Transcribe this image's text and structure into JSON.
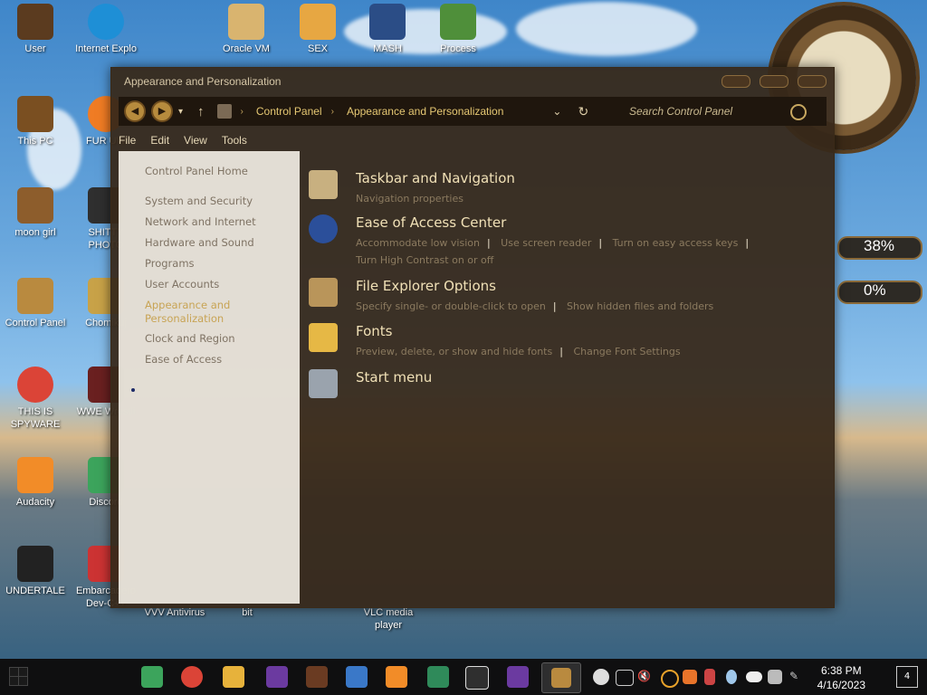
{
  "desktop": {
    "icons": [
      {
        "label": "User",
        "icon": "user-folder-icon",
        "color": "#5b3b1f"
      },
      {
        "label": "This PC",
        "icon": "this-pc-icon",
        "color": "#7a4f21"
      },
      {
        "label": "moon girl",
        "icon": "moon-girl-icon",
        "color": "#8d5d2c"
      },
      {
        "label": "Control Panel",
        "icon": "control-panel-icon",
        "color": "#b98a3f"
      },
      {
        "label": "THIS IS SPYWARE",
        "icon": "chrome-icon",
        "color": "#db4437"
      },
      {
        "label": "Audacity",
        "icon": "audacity-icon",
        "color": "#f28c28"
      },
      {
        "label": "UNDERTALE",
        "icon": "unity-icon",
        "color": "#222222"
      }
    ],
    "icons_col2": [
      {
        "label": "Internet Explo",
        "icon": "edge-icon",
        "color": "#1e8fd6"
      },
      {
        "label": "FUR UW",
        "icon": "firefox-icon",
        "color": "#f07c24"
      },
      {
        "label": "SHITTY PHOTO",
        "icon": "cat-icon",
        "color": "#2f2f2f"
      },
      {
        "label": "Chomikuj",
        "icon": "chomik-icon",
        "color": "#c8a248"
      },
      {
        "label": "WWE Wrestli",
        "icon": "wwe-icon",
        "color": "#6a2020"
      },
      {
        "label": "Discord",
        "icon": "discord-icon",
        "color": "#3ca45c"
      },
      {
        "label": "Embarcadero Dev-C++",
        "icon": "devcpp-icon",
        "color": "#cc3333"
      }
    ],
    "top_row": [
      {
        "label": "Oracle VM",
        "icon": "virtualbox-icon"
      },
      {
        "label": "SEX",
        "icon": "sex-icon"
      },
      {
        "label": "MASH",
        "icon": "mash-icon"
      },
      {
        "label": "Process",
        "icon": "process-icon"
      }
    ],
    "bottom_row": [
      {
        "label": "VVV Antivirus"
      },
      {
        "label": "bit"
      },
      {
        "label": "VLC media player"
      }
    ],
    "meters": [
      {
        "text": "38%",
        "level": 0.38
      },
      {
        "text": "0%",
        "level": 0
      }
    ]
  },
  "window": {
    "title": "Appearance and Personalization",
    "breadcrumb": [
      "Control Panel",
      "Appearance and Personalization"
    ],
    "search_placeholder": "Search Control Panel",
    "menu": [
      "File",
      "Edit",
      "View",
      "Tools"
    ],
    "sidebar": [
      "Control Panel Home",
      "System and Security",
      "Network and Internet",
      "Hardware and Sound",
      "Programs",
      "User Accounts",
      "Appearance and Personalization",
      "Clock and Region",
      "Ease of Access"
    ],
    "active_sidebar": "Appearance and Personalization",
    "sections": [
      {
        "title": "Taskbar and Navigation",
        "icon": "taskbar-icon",
        "links": [
          "Navigation properties"
        ]
      },
      {
        "title": "Ease of Access Center",
        "icon": "ease-of-access-icon",
        "links": [
          "Accommodate low vision",
          "Use screen reader",
          "Turn on easy access keys",
          "Turn High Contrast on or off"
        ]
      },
      {
        "title": "File Explorer Options",
        "icon": "folder-options-icon",
        "links": [
          "Specify single- or double-click to open",
          "Show hidden files and folders"
        ]
      },
      {
        "title": "Fonts",
        "icon": "fonts-icon",
        "links": [
          "Preview, delete, or show and hide fonts",
          "Change Font Settings"
        ]
      },
      {
        "title": "Start menu",
        "icon": "start-menu-icon",
        "links": []
      }
    ]
  },
  "taskbar": {
    "time": "6:38 PM",
    "date": "4/16/2023",
    "notifications": "4",
    "apps": [
      "discord-icon",
      "chrome-icon",
      "explorer-icon",
      "bonzi-icon",
      "winamp-icon",
      "windows-icon",
      "vlc-icon",
      "terminal-icon",
      "cat-icon",
      "bonzi2-icon",
      "control-panel-icon"
    ],
    "tray": [
      "cow-icon",
      "network-icon",
      "volume-mute-icon",
      "search-icon",
      "paint-icon",
      "bottle-icon",
      "drop-icon",
      "cloud-icon",
      "chess-icon",
      "pen-icon"
    ]
  }
}
